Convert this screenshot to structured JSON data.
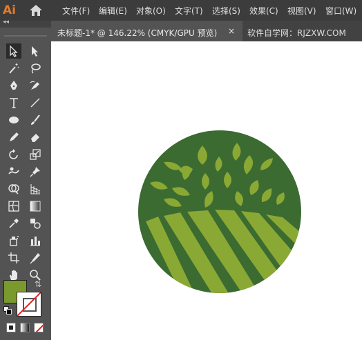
{
  "app": {
    "logo": "Ai",
    "home_icon": "home-icon"
  },
  "menu": [
    "文件(F)",
    "编辑(E)",
    "对象(O)",
    "文字(T)",
    "选择(S)",
    "效果(C)",
    "视图(V)",
    "窗口(W)"
  ],
  "tabs": [
    {
      "title": "未标题-1* @ 146.22% (CMYK/GPU 预览)",
      "close": "×"
    },
    {
      "title": "软件自学网：RJZXW.COM"
    }
  ],
  "toolbar": {
    "collapse": "◂◂",
    "tools": [
      "selection-tool-icon",
      "direct-selection-tool-icon",
      "magic-wand-tool-icon",
      "lasso-tool-icon",
      "pen-tool-icon",
      "curvature-tool-icon",
      "type-tool-icon",
      "line-segment-tool-icon",
      "ellipse-tool-icon",
      "paintbrush-tool-icon",
      "pencil-tool-icon",
      "eraser-tool-icon",
      "rotate-tool-icon",
      "scale-tool-icon",
      "warp-tool-icon",
      "pin-tool-icon",
      "shape-builder-tool-icon",
      "perspective-grid-tool-icon",
      "mesh-tool-icon",
      "gradient-tool-icon",
      "eyedropper-tool-icon",
      "blend-tool-icon",
      "symbol-sprayer-tool-icon",
      "column-graph-tool-icon",
      "artboard-tool-icon",
      "slice-tool-icon",
      "hand-tool-icon",
      "zoom-tool-icon"
    ],
    "fill_color": "#7a9a2e",
    "swap": "⇅"
  },
  "colors": {
    "circle": "#3b6b31",
    "leaf": "#8aa834"
  }
}
